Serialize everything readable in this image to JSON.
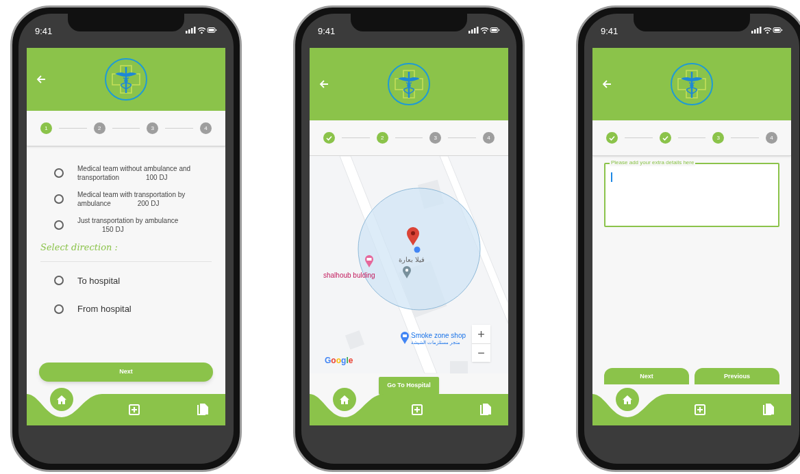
{
  "phones": [
    {
      "status_bar": {
        "time": "9:41"
      },
      "steps": [
        {
          "label": "1",
          "done": false,
          "current": true
        },
        {
          "label": "2",
          "done": false,
          "current": false
        },
        {
          "label": "3",
          "done": false,
          "current": false
        },
        {
          "label": "4",
          "done": false,
          "current": false
        }
      ],
      "screen": {
        "kind": "options",
        "options": [
          {
            "text": "Medical team without ambulance and transportation",
            "price": "100 DJ",
            "selected": false
          },
          {
            "text": "Medical team with transportation by ambulance",
            "price": "200 DJ",
            "selected": false
          },
          {
            "text": "Just transportation by ambulance",
            "price": "150 DJ",
            "selected": false
          }
        ],
        "section_title": "Select direction :",
        "directions": [
          {
            "text": "To hospital",
            "selected": false
          },
          {
            "text": "From hospital",
            "selected": false
          }
        ],
        "buttons": [
          {
            "label": "Next"
          }
        ]
      },
      "nav": [
        {
          "kind": "home",
          "selected": true
        },
        {
          "kind": "add",
          "selected": false
        },
        {
          "kind": "documents",
          "selected": false
        }
      ]
    },
    {
      "status_bar": {
        "time": "9:41"
      },
      "steps": [
        {
          "done": true,
          "current": false
        },
        {
          "label": "2",
          "done": false,
          "current": true
        },
        {
          "label": "3",
          "done": false,
          "current": false
        },
        {
          "label": "4",
          "done": false,
          "current": false
        }
      ],
      "screen": {
        "kind": "map",
        "places": [
          {
            "kind": "hotel",
            "name": "shalhoub bulding"
          },
          {
            "kind": "place",
            "name": "فيلا بعارة"
          },
          {
            "kind": "shop",
            "name": "Smoke zone shop",
            "subtitle": "متجر مستلزمات الشيشة"
          }
        ],
        "attribution": "Google",
        "zoom_controls": [
          "+",
          "−"
        ],
        "buttons": [
          {
            "label": "Go To Hospital"
          }
        ]
      },
      "nav": [
        {
          "kind": "home",
          "selected": true
        },
        {
          "kind": "add",
          "selected": false
        },
        {
          "kind": "documents",
          "selected": false
        }
      ]
    },
    {
      "status_bar": {
        "time": "9:41"
      },
      "steps": [
        {
          "done": true,
          "current": false
        },
        {
          "done": true,
          "current": false
        },
        {
          "label": "3",
          "done": false,
          "current": true
        },
        {
          "label": "4",
          "done": false,
          "current": false
        }
      ],
      "screen": {
        "kind": "details",
        "details_field": {
          "label": "Please add your extra details here",
          "focused": true
        },
        "buttons": [
          {
            "label": "Next"
          },
          {
            "label": "Previous"
          }
        ]
      },
      "nav": [
        {
          "kind": "home",
          "selected": true
        },
        {
          "kind": "add",
          "selected": false
        },
        {
          "kind": "documents",
          "selected": false
        }
      ]
    }
  ]
}
